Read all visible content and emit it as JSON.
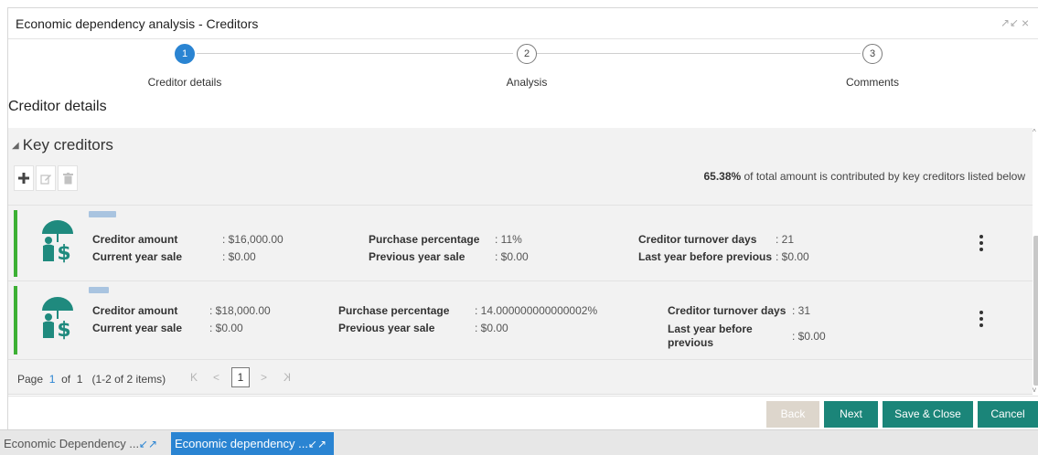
{
  "window": {
    "title": "Economic dependency analysis - Creditors",
    "minimize_glyph": "↗↙",
    "close_glyph": "×"
  },
  "stepper": {
    "steps": [
      {
        "number": "1",
        "label": "Creditor details",
        "active": true
      },
      {
        "number": "2",
        "label": "Analysis",
        "active": false
      },
      {
        "number": "3",
        "label": "Comments",
        "active": false
      }
    ]
  },
  "section": {
    "title": "Creditor details"
  },
  "panel": {
    "heading": "Key creditors",
    "collapse_glyph": "◢",
    "toolbar_icons": [
      "add-icon",
      "edit-icon",
      "delete-icon"
    ],
    "summary_bold": "65.38%",
    "summary_rest": " of total amount is contributed by key creditors listed below"
  },
  "creditors": [
    {
      "fields": [
        {
          "label": "Creditor amount",
          "value": ": $16,000.00"
        },
        {
          "label": "Current year sale",
          "value": ": $0.00"
        },
        {
          "label": "Purchase percentage",
          "value": ": 11%"
        },
        {
          "label": "Previous year sale",
          "value": ": $0.00"
        },
        {
          "label": "Creditor turnover days",
          "value": ": 21"
        },
        {
          "label": "Last year before previous",
          "value": ": $0.00"
        }
      ]
    },
    {
      "fields": [
        {
          "label": "Creditor amount",
          "value": ": $18,000.00"
        },
        {
          "label": "Current year sale",
          "value": ": $0.00"
        },
        {
          "label": "Purchase percentage",
          "value": ": 14.000000000000002%"
        },
        {
          "label": "Previous year sale",
          "value": ": $0.00"
        },
        {
          "label": "Creditor turnover days",
          "value": ": 31"
        },
        {
          "label": "Last year before previous",
          "value": ": $0.00"
        }
      ]
    }
  ],
  "pager": {
    "page_word": "Page",
    "page": "1",
    "of_word": "of",
    "total_pages": "1",
    "items_text": "(1-2 of 2 items)",
    "first_glyph": "K",
    "prev_glyph": "<",
    "current": "1",
    "next_glyph": ">",
    "last_glyph": "K"
  },
  "footer": {
    "back": "Back",
    "next": "Next",
    "save_close": "Save & Close",
    "cancel": "Cancel"
  },
  "taskbar": {
    "tasks": [
      {
        "label": "Economic Dependency ...",
        "active": false
      },
      {
        "label": "Economic dependency ...",
        "active": true
      }
    ],
    "expand_glyph": "↙↗"
  },
  "colors": {
    "accent_blue": "#2a84d2",
    "primary_teal": "#1b8579",
    "card_accent_green": "#3cb034",
    "avatar_teal": "#1f8a7e"
  }
}
